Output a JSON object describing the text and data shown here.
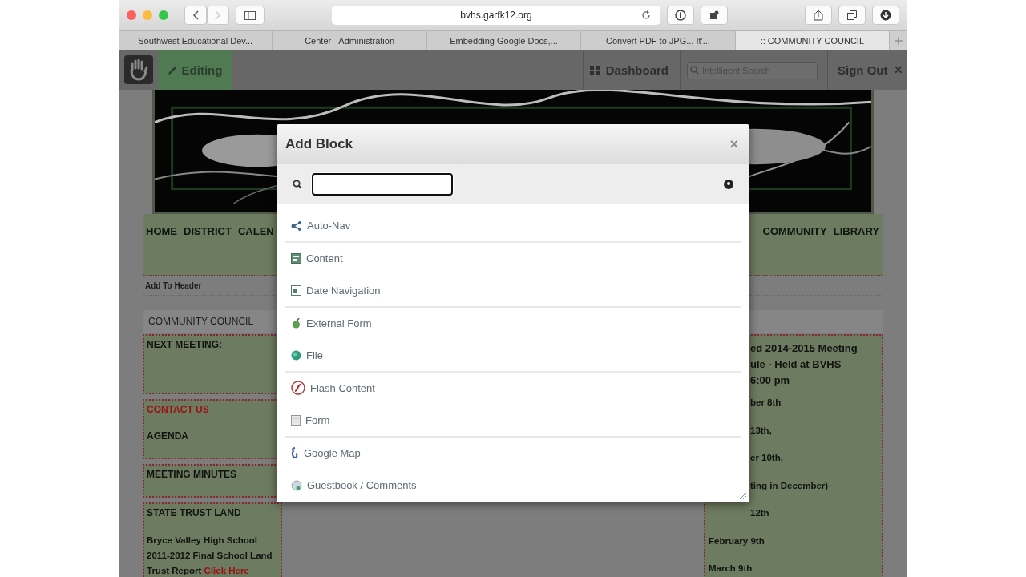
{
  "browser": {
    "url": "bvhs.garfk12.org",
    "tabs": [
      {
        "label": "Southwest Educational Dev...",
        "selected": false
      },
      {
        "label": "Center - Administration",
        "selected": false
      },
      {
        "label": "Embedding Google Docs,...",
        "selected": false
      },
      {
        "label": "Convert PDF to JPG... It'...",
        "selected": false
      },
      {
        "label": ":: COMMUNITY COUNCIL",
        "selected": true
      }
    ]
  },
  "toolbar": {
    "mode": "Editing",
    "dashboard": "Dashboard",
    "search_placeholder": "Intelligent Search",
    "sign_out": "Sign Out",
    "close": "×"
  },
  "page": {
    "nav_left": [
      "HOME",
      "DISTRICT",
      "CALEN"
    ],
    "nav_right": [
      "COMMUNITY",
      "LIBRARY"
    ],
    "add_to_header": "Add To Header",
    "section_title": "COMMUNITY COUNCIL",
    "left_blocks": [
      {
        "lines": [
          {
            "text": "NEXT MEETING:",
            "kind": "underlined"
          }
        ]
      },
      {
        "lines": [
          {
            "text": "CONTACT US",
            "kind": "alert"
          },
          {
            "text": "AGENDA",
            "kind": "plain"
          }
        ]
      },
      {
        "lines": [
          {
            "text": "MEETING MINUTES",
            "kind": "plain"
          }
        ]
      },
      {
        "lines": [
          {
            "text": "STATE TRUST LAND",
            "kind": "plain"
          },
          {
            "text": "Bryce Valley High School 2011-2012 Final School Land Trust Report",
            "link": "Click Here",
            "kind": "report"
          }
        ]
      }
    ],
    "right_block": [
      {
        "text": "ed 2014-2015  Meeting",
        "kind": "cut-heading"
      },
      {
        "text": "ule -  Held at BVHS",
        "kind": "cut-heading"
      },
      {
        "text": "6:00 pm",
        "kind": "cut-heading"
      },
      {
        "text": "ber 8th",
        "kind": "cut"
      },
      {
        "text": "13th,",
        "kind": "cut"
      },
      {
        "text": "er 10th,",
        "kind": "cut"
      },
      {
        "text": "ting in December)",
        "kind": "cut"
      },
      {
        "text": "12th",
        "kind": "cut"
      },
      {
        "text": "February 9th",
        "kind": "full"
      },
      {
        "text": "March 9th",
        "kind": "full"
      }
    ]
  },
  "modal": {
    "title": "Add Block",
    "close": "×",
    "items": [
      {
        "label": "Auto-Nav",
        "divider_below": true
      },
      {
        "label": "Content",
        "divider_below": false
      },
      {
        "label": "Date Navigation",
        "divider_below": true
      },
      {
        "label": "External Form",
        "divider_below": false
      },
      {
        "label": "File",
        "divider_below": true
      },
      {
        "label": "Flash Content",
        "divider_below": false
      },
      {
        "label": "Form",
        "divider_below": true
      },
      {
        "label": "Google Map",
        "divider_below": false
      },
      {
        "label": "Guestbook / Comments",
        "divider_below": false
      }
    ]
  }
}
